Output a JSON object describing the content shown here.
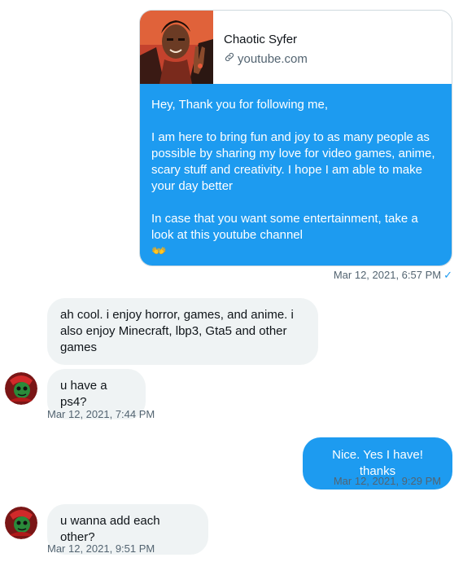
{
  "colors": {
    "sent_bubble": "#1d9bf0",
    "received_bubble": "#eff3f4",
    "timestamp_text": "#536471",
    "read_check": "#1d9bf0"
  },
  "link_card": {
    "title": "Chaotic Syfer",
    "url": "youtube.com",
    "url_icon": "link-icon",
    "thumbnail": "channel-thumbnail-image",
    "message_paragraphs": [
      "Hey, Thank you for following me,",
      "I am here to bring fun and joy to as many people as possible by sharing my love for video games, anime, scary stuff and creativity. I hope I am able to make your day better",
      "In case that you want some entertainment, take a look at this youtube channel"
    ],
    "emoji": "👐",
    "timestamp": "Mar 12, 2021, 6:57 PM"
  },
  "received_1": {
    "messages": [
      "ah cool. i enjoy horror, games, and anime. i also enjoy Minecraft, lbp3, Gta5 and other games",
      "u have a ps4?"
    ],
    "timestamp": "Mar 12, 2021, 7:44 PM"
  },
  "sent_2": {
    "message": "Nice. Yes I have! thanks",
    "timestamp": "Mar 12, 2021, 9:29 PM"
  },
  "received_2": {
    "message": "u wanna add each other?",
    "timestamp": "Mar 12, 2021, 9:51 PM"
  },
  "icons": {
    "read_receipt": "checkmark-icon",
    "avatar": "user-avatar"
  }
}
